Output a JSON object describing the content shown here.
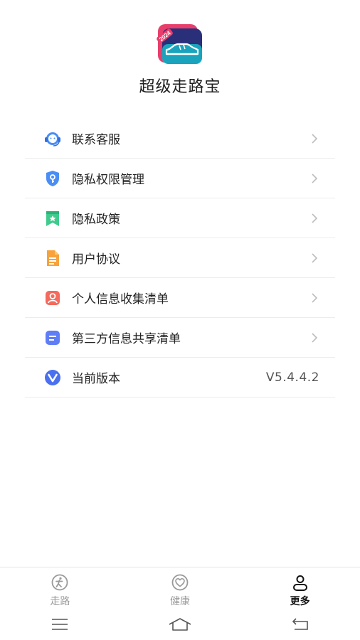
{
  "app": {
    "title": "超级走路宝",
    "logo_badge": "2024"
  },
  "menu": {
    "items": [
      {
        "label": "联系客服",
        "icon": "customer-service-icon"
      },
      {
        "label": "隐私权限管理",
        "icon": "privacy-shield-icon"
      },
      {
        "label": "隐私政策",
        "icon": "policy-bookmark-icon"
      },
      {
        "label": "用户协议",
        "icon": "document-icon"
      },
      {
        "label": "个人信息收集清单",
        "icon": "person-icon"
      },
      {
        "label": "第三方信息共享清单",
        "icon": "list-icon"
      }
    ],
    "version": {
      "label": "当前版本",
      "value": "V5.4.4.2",
      "icon": "version-v-icon"
    }
  },
  "tabbar": {
    "tabs": [
      {
        "label": "走路",
        "icon": "walk-icon",
        "active": false
      },
      {
        "label": "健康",
        "icon": "heart-icon",
        "active": false
      },
      {
        "label": "更多",
        "icon": "user-icon",
        "active": true
      }
    ]
  },
  "colors": {
    "accent": "#222222",
    "inactive_tab": "#9a9a9a",
    "divider": "#ececec",
    "icon_blue": "#4a8ef5",
    "icon_green": "#3ecb8c",
    "icon_orange": "#f7a23b",
    "icon_red": "#f46a5c",
    "icon_indigo": "#5f7df5"
  }
}
